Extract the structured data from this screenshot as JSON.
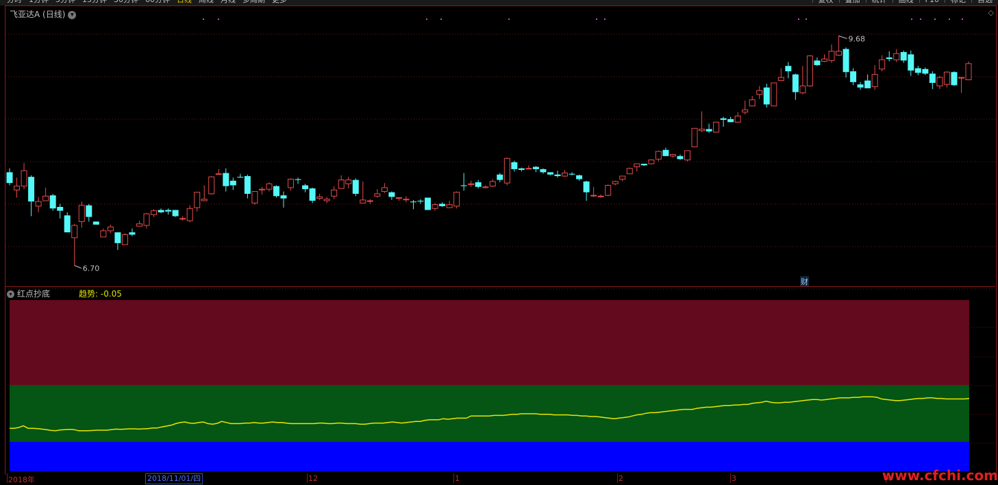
{
  "toolbar": {
    "tabs": [
      "分时",
      "1分钟",
      "5分钟",
      "15分钟",
      "30分钟",
      "60分钟",
      "日线",
      "周线",
      "月线",
      "多周期",
      "更多"
    ],
    "active_tab": "日线",
    "right_buttons": [
      "复权",
      "叠加",
      "统计",
      "画线",
      "F10",
      "标记",
      "自选"
    ]
  },
  "chart": {
    "title": "飞亚达A (日线)",
    "max_label": "9.68",
    "min_label": "6.70",
    "event_marker": "财"
  },
  "indicator": {
    "name": "红点抄底",
    "value_label": "趋势: -0.05",
    "colors": {
      "top_band": "#640a1e",
      "middle_band": "#055514",
      "bottom_band": "#0000ff",
      "line": "#e8e800"
    }
  },
  "axis": {
    "cursor_label": "2018/11/01/四",
    "ticks": [
      "2018年",
      "12",
      "1",
      "2",
      "3",
      "4"
    ]
  },
  "watermark": "www.cfchi.com",
  "chart_data": {
    "type": "candlestick",
    "title": "飞亚达A (日线)",
    "colors": {
      "up": "#e84c4c",
      "down": "#54f8f8"
    },
    "ylim": [
      6.5,
      9.95
    ],
    "candles": [
      [
        7.91,
        7.77,
        7.96,
        7.74
      ],
      [
        7.68,
        7.73,
        7.84,
        7.58
      ],
      [
        7.73,
        7.93,
        8.03,
        7.69
      ],
      [
        7.85,
        7.53,
        7.87,
        7.34
      ],
      [
        7.47,
        7.53,
        7.59,
        7.39
      ],
      [
        7.54,
        7.6,
        7.71,
        7.54
      ],
      [
        7.61,
        7.44,
        7.63,
        7.41
      ],
      [
        7.46,
        7.41,
        7.5,
        7.31
      ],
      [
        7.35,
        7.13,
        7.39,
        7.13
      ],
      [
        7.06,
        7.22,
        7.24,
        6.7
      ],
      [
        7.27,
        7.48,
        7.53,
        7.19
      ],
      [
        7.48,
        7.33,
        7.5,
        7.27
      ],
      [
        7.27,
        7.23,
        7.27,
        7.25
      ],
      [
        7.07,
        7.15,
        7.18,
        7.07
      ],
      [
        7.15,
        7.2,
        7.23,
        7.12
      ],
      [
        7.13,
        6.99,
        7.13,
        6.9
      ],
      [
        6.97,
        7.1,
        7.12,
        6.97
      ],
      [
        7.13,
        7.1,
        7.18,
        7.08
      ],
      [
        7.21,
        7.24,
        7.28,
        7.21
      ],
      [
        7.22,
        7.37,
        7.38,
        7.18
      ],
      [
        7.36,
        7.41,
        7.43,
        7.33
      ],
      [
        7.42,
        7.39,
        7.44,
        7.38
      ],
      [
        7.42,
        7.4,
        7.44,
        7.36
      ],
      [
        7.42,
        7.34,
        7.42,
        7.33
      ],
      [
        7.31,
        7.31,
        7.34,
        7.28
      ],
      [
        7.28,
        7.44,
        7.48,
        7.26
      ],
      [
        7.45,
        7.65,
        7.65,
        7.4
      ],
      [
        7.54,
        7.56,
        7.74,
        7.56
      ],
      [
        7.63,
        7.85,
        7.86,
        7.62
      ],
      [
        7.88,
        7.89,
        7.95,
        7.88
      ],
      [
        7.9,
        7.73,
        7.96,
        7.66
      ],
      [
        7.8,
        7.74,
        7.84,
        7.68
      ],
      [
        7.85,
        7.84,
        7.89,
        7.84
      ],
      [
        7.86,
        7.63,
        7.88,
        7.57
      ],
      [
        7.51,
        7.66,
        7.66,
        7.49
      ],
      [
        7.68,
        7.69,
        7.72,
        7.62
      ],
      [
        7.69,
        7.76,
        7.78,
        7.66
      ],
      [
        7.73,
        7.6,
        7.74,
        7.58
      ],
      [
        7.61,
        7.57,
        7.66,
        7.45
      ],
      [
        7.71,
        7.82,
        7.83,
        7.67
      ],
      [
        7.82,
        7.81,
        7.84,
        7.76
      ],
      [
        7.74,
        7.69,
        7.76,
        7.65
      ],
      [
        7.7,
        7.54,
        7.71,
        7.51
      ],
      [
        7.57,
        7.59,
        7.63,
        7.55
      ],
      [
        7.54,
        7.56,
        7.59,
        7.51
      ],
      [
        7.6,
        7.68,
        7.73,
        7.56
      ],
      [
        7.7,
        7.81,
        7.87,
        7.7
      ],
      [
        7.76,
        7.81,
        7.85,
        7.7
      ],
      [
        7.81,
        7.63,
        7.83,
        7.6
      ],
      [
        7.51,
        7.55,
        7.79,
        7.52
      ],
      [
        7.54,
        7.54,
        7.56,
        7.5
      ],
      [
        7.6,
        7.63,
        7.69,
        7.58
      ],
      [
        7.66,
        7.71,
        7.77,
        7.64
      ],
      [
        7.65,
        7.59,
        7.66,
        7.55
      ],
      [
        7.58,
        7.58,
        7.58,
        7.54
      ],
      [
        7.56,
        7.56,
        7.6,
        7.52
      ],
      [
        7.53,
        7.52,
        7.55,
        7.43
      ],
      [
        7.54,
        7.53,
        7.56,
        7.5
      ],
      [
        7.58,
        7.42,
        7.58,
        7.42
      ],
      [
        7.44,
        7.49,
        7.51,
        7.41
      ],
      [
        7.5,
        7.47,
        7.52,
        7.46
      ],
      [
        7.45,
        7.49,
        7.54,
        7.45
      ],
      [
        7.47,
        7.65,
        7.66,
        7.44
      ],
      [
        7.74,
        7.73,
        7.9,
        7.67
      ],
      [
        7.75,
        7.76,
        7.8,
        7.72
      ],
      [
        7.78,
        7.72,
        7.81,
        7.7
      ],
      [
        7.71,
        7.72,
        7.74,
        7.7
      ],
      [
        7.73,
        7.79,
        7.82,
        7.72
      ],
      [
        7.88,
        7.81,
        7.9,
        7.78
      ],
      [
        7.77,
        8.09,
        8.1,
        7.74
      ],
      [
        8.04,
        7.95,
        8.06,
        7.92
      ],
      [
        7.96,
        7.94,
        7.97,
        7.92
      ],
      [
        7.96,
        7.96,
        8.0,
        7.95
      ],
      [
        7.98,
        7.95,
        7.99,
        7.91
      ],
      [
        7.95,
        7.91,
        7.96,
        7.89
      ],
      [
        7.91,
        7.88,
        7.91,
        7.87
      ],
      [
        7.88,
        7.86,
        7.93,
        7.84
      ],
      [
        7.86,
        7.9,
        7.94,
        7.85
      ],
      [
        7.89,
        7.88,
        7.91,
        7.87
      ],
      [
        7.87,
        7.82,
        7.88,
        7.8
      ],
      [
        7.79,
        7.65,
        7.8,
        7.54
      ],
      [
        7.61,
        7.61,
        7.72,
        7.59
      ],
      [
        7.6,
        7.6,
        7.62,
        7.58
      ],
      [
        7.61,
        7.74,
        7.75,
        7.6
      ],
      [
        7.76,
        7.79,
        7.8,
        7.74
      ],
      [
        7.82,
        7.86,
        7.86,
        7.79
      ],
      [
        7.89,
        7.96,
        7.97,
        7.89
      ],
      [
        7.98,
        8.02,
        8.01,
        7.92
      ],
      [
        8.02,
        8.0,
        8.02,
        7.99
      ],
      [
        8.02,
        8.07,
        8.08,
        8.01
      ],
      [
        8.08,
        8.18,
        8.19,
        8.05
      ],
      [
        8.2,
        8.12,
        8.23,
        8.12
      ],
      [
        8.12,
        8.14,
        8.15,
        8.1
      ],
      [
        8.12,
        8.08,
        8.14,
        8.07
      ],
      [
        8.07,
        8.19,
        8.19,
        8.05
      ],
      [
        8.24,
        8.48,
        8.48,
        8.24
      ],
      [
        8.45,
        8.47,
        8.7,
        8.43
      ],
      [
        8.47,
        8.44,
        8.54,
        8.42
      ],
      [
        8.43,
        8.56,
        8.56,
        8.43
      ],
      [
        8.61,
        8.59,
        8.63,
        8.5
      ],
      [
        8.6,
        8.56,
        8.63,
        8.56
      ],
      [
        8.56,
        8.64,
        8.69,
        8.56
      ],
      [
        8.69,
        8.72,
        8.84,
        8.66
      ],
      [
        8.77,
        8.85,
        8.9,
        8.77
      ],
      [
        8.92,
        8.97,
        9.03,
        8.86
      ],
      [
        9.01,
        8.79,
        9.06,
        8.75
      ],
      [
        8.77,
        9.07,
        9.07,
        8.77
      ],
      [
        9.1,
        9.14,
        9.26,
        9.1
      ],
      [
        9.29,
        9.22,
        9.34,
        9.13
      ],
      [
        9.18,
        8.95,
        9.19,
        8.85
      ],
      [
        8.94,
        9.03,
        9.29,
        8.92
      ],
      [
        9.03,
        9.42,
        9.43,
        9.02
      ],
      [
        9.36,
        9.3,
        9.4,
        9.29
      ],
      [
        9.35,
        9.38,
        9.44,
        9.34
      ],
      [
        9.36,
        9.48,
        9.57,
        9.33
      ],
      [
        9.43,
        9.48,
        9.68,
        9.42
      ],
      [
        9.51,
        9.21,
        9.53,
        9.14
      ],
      [
        9.22,
        9.08,
        9.26,
        9.04
      ],
      [
        9.05,
        9.01,
        9.08,
        8.98
      ],
      [
        9.1,
        9.0,
        9.18,
        9.0
      ],
      [
        9.02,
        9.18,
        9.3,
        8.98
      ],
      [
        9.25,
        9.37,
        9.43,
        9.22
      ],
      [
        9.4,
        9.38,
        9.48,
        9.35
      ],
      [
        9.37,
        9.45,
        9.51,
        9.34
      ],
      [
        9.47,
        9.36,
        9.49,
        9.33
      ],
      [
        9.44,
        9.23,
        9.49,
        9.16
      ],
      [
        9.26,
        9.2,
        9.29,
        9.17
      ],
      [
        9.25,
        9.19,
        9.27,
        9.17
      ],
      [
        9.19,
        9.07,
        9.22,
        8.99
      ],
      [
        9.03,
        9.14,
        9.16,
        8.99
      ],
      [
        9.05,
        9.21,
        9.22,
        9.01
      ],
      [
        9.21,
        9.04,
        9.22,
        9.03
      ],
      [
        9.14,
        9.14,
        9.14,
        8.94
      ],
      [
        9.11,
        9.32,
        9.35,
        9.11
      ]
    ],
    "indicator_line": [
      0.185,
      0.185,
      0.2,
      0.23,
      0.185,
      0.185,
      0.18,
      0.17,
      0.16,
      0.145,
      0.14,
      0.155,
      0.16,
      0.165,
      0.16,
      0.14,
      0.14,
      0.14,
      0.145,
      0.15,
      0.15,
      0.15,
      0.16,
      0.17,
      0.165,
      0.17,
      0.175,
      0.175,
      0.17,
      0.175,
      0.18,
      0.19,
      0.19,
      0.21,
      0.225,
      0.24,
      0.27,
      0.29,
      0.3,
      0.28,
      0.275,
      0.29,
      0.3,
      0.27,
      0.26,
      0.275,
      0.31,
      0.29,
      0.27,
      0.27,
      0.27,
      0.28,
      0.28,
      0.29,
      0.28,
      0.28,
      0.29,
      0.3,
      0.29,
      0.29,
      0.28,
      0.27,
      0.27,
      0.27,
      0.27,
      0.27,
      0.27,
      0.28,
      0.28,
      0.27,
      0.27,
      0.28,
      0.28,
      0.27,
      0.27,
      0.27,
      0.26,
      0.26,
      0.27,
      0.28,
      0.28,
      0.28,
      0.29,
      0.3,
      0.29,
      0.28,
      0.29,
      0.3,
      0.31,
      0.31,
      0.33,
      0.34,
      0.34,
      0.34,
      0.36,
      0.35,
      0.36,
      0.37,
      0.37,
      0.37,
      0.41,
      0.41,
      0.41,
      0.41,
      0.41,
      0.42,
      0.42,
      0.42,
      0.43,
      0.44,
      0.44,
      0.45,
      0.45,
      0.45,
      0.45,
      0.44,
      0.44,
      0.44,
      0.43,
      0.43,
      0.43,
      0.43,
      0.42,
      0.42,
      0.41,
      0.41,
      0.4,
      0.4,
      0.39,
      0.38,
      0.37,
      0.36,
      0.37,
      0.38,
      0.39,
      0.41,
      0.43,
      0.44,
      0.46,
      0.47,
      0.47,
      0.48,
      0.49,
      0.5,
      0.51,
      0.52,
      0.53,
      0.53,
      0.53,
      0.55,
      0.56,
      0.57,
      0.57,
      0.58,
      0.59,
      0.6,
      0.6,
      0.61,
      0.61,
      0.62,
      0.62,
      0.64,
      0.65,
      0.66,
      0.68,
      0.66,
      0.65,
      0.65,
      0.66,
      0.66,
      0.67,
      0.68,
      0.69,
      0.7,
      0.71,
      0.71,
      0.7,
      0.71,
      0.72,
      0.73,
      0.74,
      0.74,
      0.74,
      0.75,
      0.75,
      0.76,
      0.76,
      0.76,
      0.75,
      0.72,
      0.71,
      0.7,
      0.69,
      0.69,
      0.7,
      0.71,
      0.72,
      0.73,
      0.73,
      0.74,
      0.74,
      0.73,
      0.73,
      0.72,
      0.72,
      0.72,
      0.72,
      0.72,
      0.73
    ]
  }
}
